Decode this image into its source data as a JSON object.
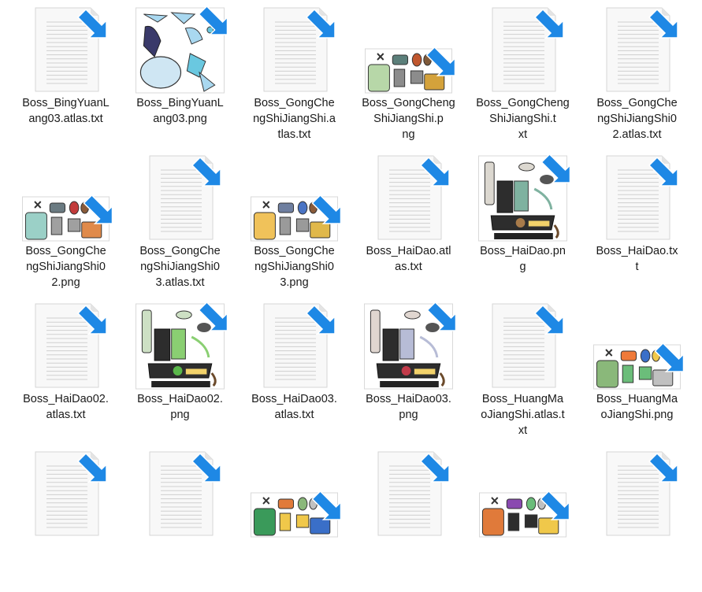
{
  "explorer": {
    "files": [
      {
        "name": "Boss_BingYuanLang03.atlas.txt",
        "label_lines": [
          "Boss_BingYuanL",
          "ang03.atlas.txt"
        ],
        "type": "txt",
        "icon": "text-file-icon"
      },
      {
        "name": "Boss_BingYuanLang03.png",
        "label_lines": [
          "Boss_BingYuanL",
          "ang03.png"
        ],
        "type": "png",
        "variant": "bingyuan",
        "icon": "image-thumbnail"
      },
      {
        "name": "Boss_GongChengShiJiangShi.atlas.txt",
        "label_lines": [
          "Boss_GongChe",
          "ngShiJiangShi.a",
          "tlas.txt"
        ],
        "type": "txt",
        "icon": "text-file-icon"
      },
      {
        "name": "Boss_GongChengShiJiangShi.png",
        "label_lines": [
          "Boss_GongCheng",
          "ShiJiangShi.p",
          "ng"
        ],
        "type": "png",
        "variant": "gongcheng",
        "icon": "image-thumbnail"
      },
      {
        "name": "Boss_GongChengShiJiangShi.txt",
        "label_lines": [
          "Boss_GongCheng",
          "ShiJiangShi.t",
          "xt"
        ],
        "type": "txt",
        "icon": "text-file-icon"
      },
      {
        "name": "Boss_GongChengShiJiangShi02.atlas.txt",
        "label_lines": [
          "Boss_GongChe",
          "ngShiJiangShi0",
          "2.atlas.txt"
        ],
        "type": "txt",
        "icon": "text-file-icon"
      },
      {
        "name": "Boss_GongChengShiJiangShi02.png",
        "label_lines": [
          "Boss_GongChe",
          "ngShiJiangShi0",
          "2.png"
        ],
        "type": "png",
        "variant": "gongcheng2",
        "icon": "image-thumbnail"
      },
      {
        "name": "Boss_GongChengShiJiangShi03.atlas.txt",
        "label_lines": [
          "Boss_GongChe",
          "ngShiJiangShi0",
          "3.atlas.txt"
        ],
        "type": "txt",
        "icon": "text-file-icon"
      },
      {
        "name": "Boss_GongChengShiJiangShi03.png",
        "label_lines": [
          "Boss_GongChe",
          "ngShiJiangShi0",
          "3.png"
        ],
        "type": "png",
        "variant": "gongcheng3",
        "icon": "image-thumbnail"
      },
      {
        "name": "Boss_HaiDao.atlas.txt",
        "label_lines": [
          "Boss_HaiDao.atl",
          "as.txt"
        ],
        "type": "txt",
        "icon": "text-file-icon"
      },
      {
        "name": "Boss_HaiDao.png",
        "label_lines": [
          "Boss_HaiDao.pn",
          "g"
        ],
        "type": "png",
        "variant": "haidao",
        "icon": "image-thumbnail"
      },
      {
        "name": "Boss_HaiDao.txt",
        "label_lines": [
          "Boss_HaiDao.tx",
          "t"
        ],
        "type": "txt",
        "icon": "text-file-icon"
      },
      {
        "name": "Boss_HaiDao02.atlas.txt",
        "label_lines": [
          "Boss_HaiDao02.",
          "atlas.txt"
        ],
        "type": "txt",
        "icon": "text-file-icon"
      },
      {
        "name": "Boss_HaiDao02.png",
        "label_lines": [
          "Boss_HaiDao02.",
          "png"
        ],
        "type": "png",
        "variant": "haidao2",
        "icon": "image-thumbnail"
      },
      {
        "name": "Boss_HaiDao03.atlas.txt",
        "label_lines": [
          "Boss_HaiDao03.",
          "atlas.txt"
        ],
        "type": "txt",
        "icon": "text-file-icon"
      },
      {
        "name": "Boss_HaiDao03.png",
        "label_lines": [
          "Boss_HaiDao03.",
          "png"
        ],
        "type": "png",
        "variant": "haidao3",
        "icon": "image-thumbnail"
      },
      {
        "name": "Boss_HuangMaoJiangShi.atlas.txt",
        "label_lines": [
          "Boss_HuangMa",
          "oJiangShi.atlas.t",
          "xt"
        ],
        "type": "txt",
        "icon": "text-file-icon"
      },
      {
        "name": "Boss_HuangMaoJiangShi.png",
        "label_lines": [
          "Boss_HuangMa",
          "oJiangShi.png"
        ],
        "type": "png",
        "variant": "huangmao",
        "icon": "image-thumbnail"
      },
      {
        "name": "",
        "label_lines": [],
        "type": "txt",
        "icon": "text-file-icon"
      },
      {
        "name": "",
        "label_lines": [],
        "type": "txt",
        "icon": "text-file-icon"
      },
      {
        "name": "",
        "label_lines": [],
        "type": "png",
        "variant": "partial1",
        "icon": "image-thumbnail"
      },
      {
        "name": "",
        "label_lines": [],
        "type": "txt",
        "icon": "text-file-icon"
      },
      {
        "name": "",
        "label_lines": [],
        "type": "png",
        "variant": "partial2",
        "icon": "image-thumbnail"
      },
      {
        "name": "",
        "label_lines": [],
        "type": "txt",
        "icon": "text-file-icon"
      }
    ],
    "colors": {
      "shortcut_arrow": "#1e88e5",
      "paper": "#f7f7f7",
      "paper_line": "#c9c9c9"
    }
  }
}
